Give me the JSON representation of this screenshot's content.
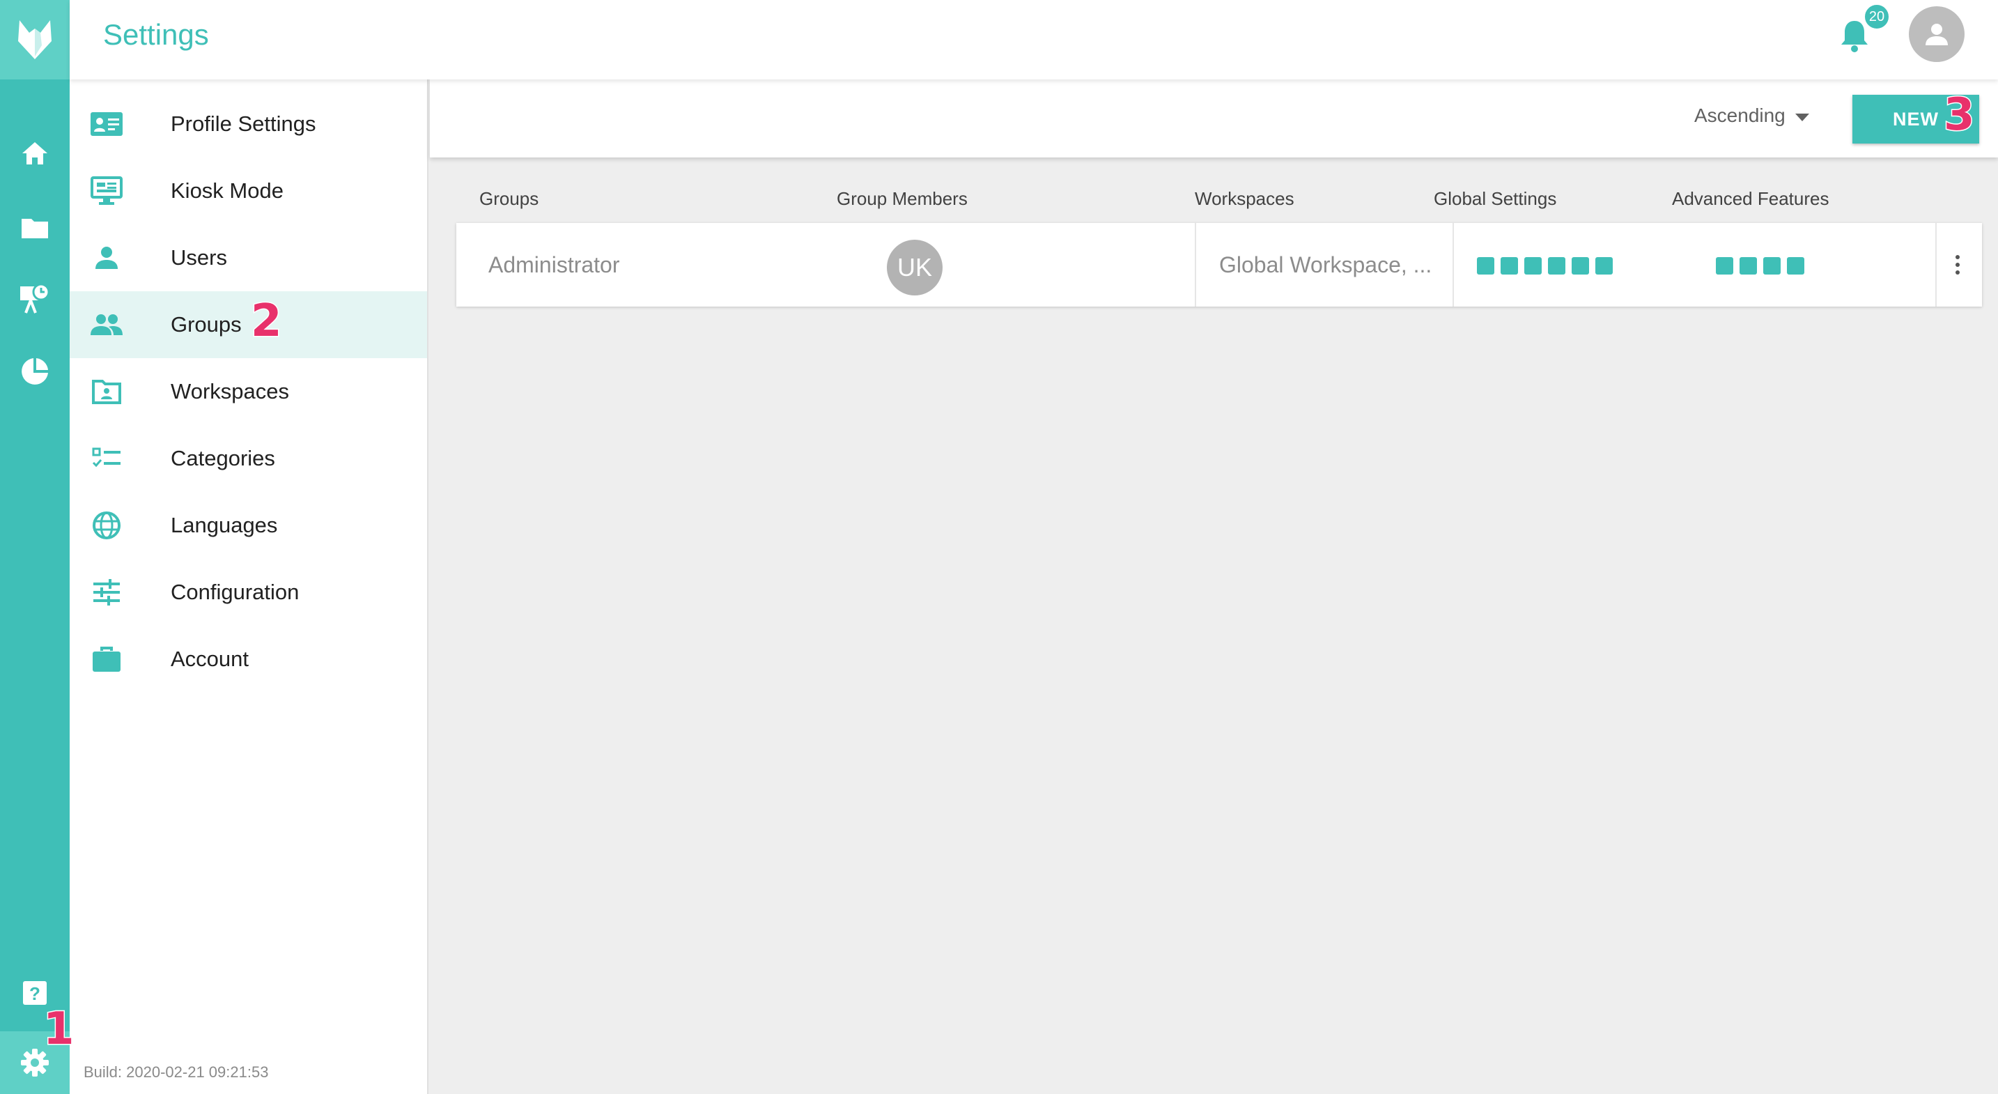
{
  "app": {
    "title": "Settings"
  },
  "colors": {
    "accent": "#3fbfb7",
    "accent_light": "#5fd0c6",
    "callout": "#e8316b",
    "active_bg": "#e4f5f3"
  },
  "rail": {
    "logo": "fox-logo-icon",
    "items": [
      "home-icon",
      "folder-icon",
      "presentation-clock-icon",
      "pie-chart-icon"
    ],
    "bottom": [
      "help-icon",
      "gear-icon"
    ]
  },
  "header": {
    "notification_count": "20",
    "notification_icon": "bell-icon",
    "avatar_icon": "user-avatar-icon"
  },
  "sidebar": {
    "items": [
      {
        "label": "Profile Settings",
        "icon": "profile-card-icon"
      },
      {
        "label": "Kiosk Mode",
        "icon": "monitor-icon"
      },
      {
        "label": "Users",
        "icon": "user-icon"
      },
      {
        "label": "Groups",
        "icon": "people-icon",
        "active": true
      },
      {
        "label": "Workspaces",
        "icon": "workspace-folder-icon"
      },
      {
        "label": "Categories",
        "icon": "checklist-icon"
      },
      {
        "label": "Languages",
        "icon": "globe-icon"
      },
      {
        "label": "Configuration",
        "icon": "sliders-icon"
      },
      {
        "label": "Account",
        "icon": "briefcase-icon"
      }
    ],
    "build": "Build: 2020-02-21 09:21:53"
  },
  "toolbar": {
    "sort_label": "Ascending",
    "new_label": "NEW"
  },
  "table": {
    "headers": [
      "Groups",
      "Group Members",
      "Workspaces",
      "Global Settings",
      "Advanced Features"
    ],
    "rows": [
      {
        "group": "Administrator",
        "member_initials": "UK",
        "workspaces": "Global Workspace, ...",
        "global_settings_count": 6,
        "advanced_features_count": 4
      }
    ]
  },
  "callouts": [
    "1",
    "2",
    "3"
  ]
}
